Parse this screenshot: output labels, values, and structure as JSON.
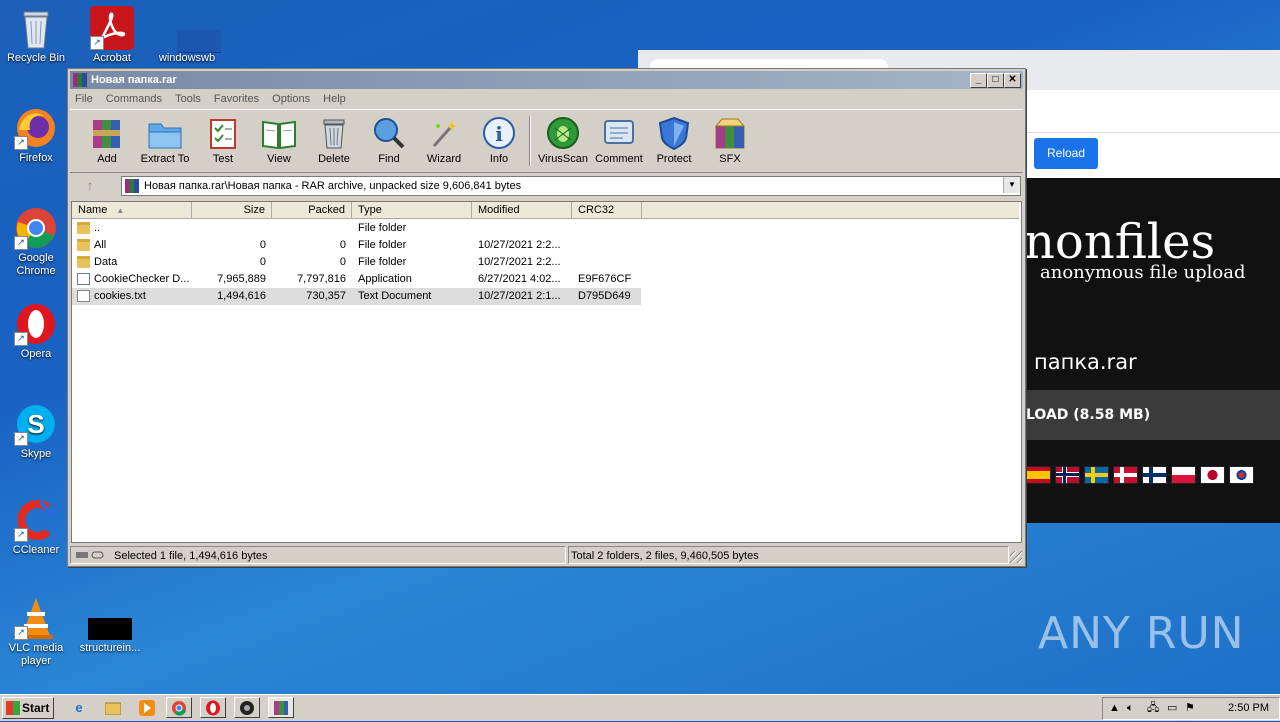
{
  "desktop": {
    "icons": [
      {
        "label": "Recycle Bin"
      },
      {
        "label": "Acrobat"
      },
      {
        "label": "windowswb"
      },
      {
        "label": "Firefox"
      },
      {
        "label": "Google Chrome"
      },
      {
        "label": "Opera"
      },
      {
        "label": "Skype"
      },
      {
        "label": "CCleaner"
      },
      {
        "label": "VLC media player"
      },
      {
        "label": "structurein..."
      }
    ]
  },
  "browser": {
    "reload_label": "Reload",
    "brand": "nonfiles",
    "tagline": "anonymous file upload",
    "filename": "папка.rar",
    "download_label": "LOAD (8.58 MB)"
  },
  "watermark": "ANY RUN",
  "winrar": {
    "title": "Новая папка.rar",
    "menu": [
      "File",
      "Commands",
      "Tools",
      "Favorites",
      "Options",
      "Help"
    ],
    "toolbar": [
      {
        "label": "Add",
        "icon": "add-archive-icon"
      },
      {
        "label": "Extract To",
        "icon": "extract-folder-icon"
      },
      {
        "label": "Test",
        "icon": "test-checklist-icon"
      },
      {
        "label": "View",
        "icon": "view-book-icon"
      },
      {
        "label": "Delete",
        "icon": "trash-bin-icon"
      },
      {
        "label": "Find",
        "icon": "magnifier-icon"
      },
      {
        "label": "Wizard",
        "icon": "magic-wand-icon"
      },
      {
        "label": "Info",
        "icon": "info-circle-icon"
      },
      {
        "label": "VirusScan",
        "icon": "virus-bug-icon"
      },
      {
        "label": "Comment",
        "icon": "comment-note-icon"
      },
      {
        "label": "Protect",
        "icon": "shield-icon"
      },
      {
        "label": "SFX",
        "icon": "sfx-box-icon"
      }
    ],
    "path": "Новая папка.rar\\Новая папка - RAR archive, unpacked size 9,606,841 bytes",
    "columns": [
      "Name",
      "Size",
      "Packed",
      "Type",
      "Modified",
      "CRC32"
    ],
    "rows": [
      {
        "name": "..",
        "size": "",
        "packed": "",
        "type": "File folder",
        "modified": "",
        "crc": "",
        "icon": "folder"
      },
      {
        "name": "All",
        "size": "0",
        "packed": "0",
        "type": "File folder",
        "modified": "10/27/2021 2:2...",
        "crc": "",
        "icon": "folder"
      },
      {
        "name": "Data",
        "size": "0",
        "packed": "0",
        "type": "File folder",
        "modified": "10/27/2021 2:2...",
        "crc": "",
        "icon": "folder"
      },
      {
        "name": "CookieChecker D...",
        "size": "7,965,889",
        "packed": "7,797,816",
        "type": "Application",
        "modified": "6/27/2021 4:02...",
        "crc": "E9F676CF",
        "icon": "app"
      },
      {
        "name": "cookies.txt",
        "size": "1,494,616",
        "packed": "730,357",
        "type": "Text Document",
        "modified": "10/27/2021 2:1...",
        "crc": "D795D649",
        "icon": "txt",
        "selected": true
      }
    ],
    "status_left": "Selected 1 file, 1,494,616 bytes",
    "status_right": "Total 2 folders, 2 files, 9,460,505 bytes"
  },
  "taskbar": {
    "start_label": "Start",
    "clock": "2:50 PM"
  }
}
